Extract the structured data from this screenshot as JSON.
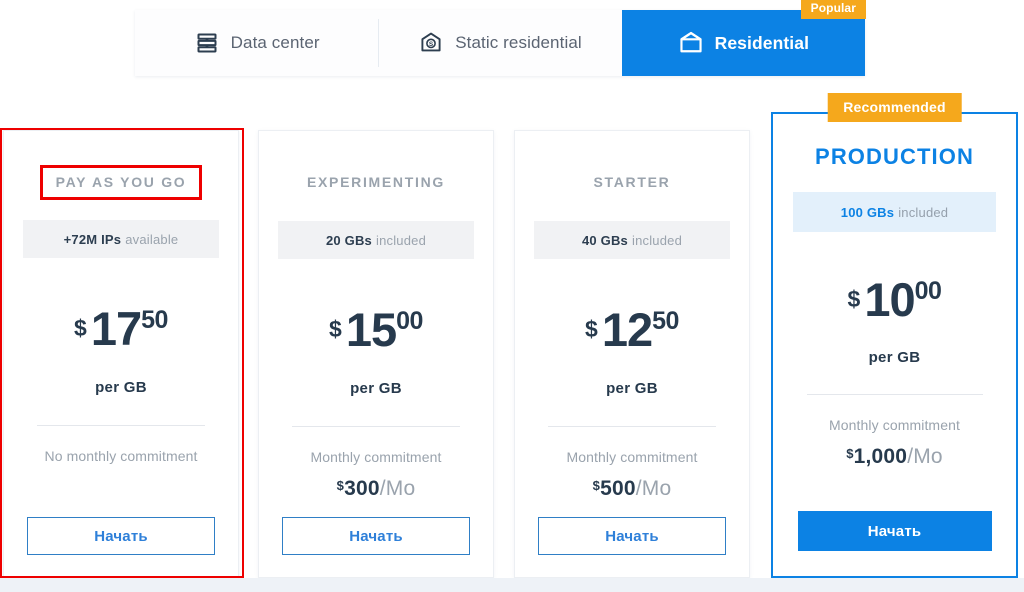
{
  "tabs": [
    {
      "label": "Data center",
      "icon": "server-rack-icon",
      "active": false,
      "badge": null
    },
    {
      "label": "Static residential",
      "icon": "house-dollar-icon",
      "active": false,
      "badge": null
    },
    {
      "label": "Residential",
      "icon": "house-icon",
      "active": true,
      "badge": "Popular"
    }
  ],
  "colors": {
    "accent_blue": "#0c82e4",
    "badge_orange": "#f5a81c",
    "annotation_red": "#ee0000",
    "price_navy": "#273a4d",
    "muted_gray": "#9aa3ad"
  },
  "plans": [
    {
      "id": "pay-as-you-go",
      "title": "PAY AS YOU GO",
      "chip_bold": "+72M IPs",
      "chip_rest": "available",
      "price_currency": "$",
      "price_int": "17",
      "price_frac": "50",
      "per_unit": "per GB",
      "commitment_label": "No monthly commitment",
      "commitment_currency": "",
      "commitment_amount": "",
      "commitment_period": "",
      "cta_label": "Начать",
      "highlighted": false,
      "annotated": true,
      "badge": null
    },
    {
      "id": "experimenting",
      "title": "EXPERIMENTING",
      "chip_bold": "20 GBs",
      "chip_rest": "included",
      "price_currency": "$",
      "price_int": "15",
      "price_frac": "00",
      "per_unit": "per GB",
      "commitment_label": "Monthly commitment",
      "commitment_currency": "$",
      "commitment_amount": "300",
      "commitment_period": "/Mo",
      "cta_label": "Начать",
      "highlighted": false,
      "annotated": false,
      "badge": null
    },
    {
      "id": "starter",
      "title": "STARTER",
      "chip_bold": "40 GBs",
      "chip_rest": "included",
      "price_currency": "$",
      "price_int": "12",
      "price_frac": "50",
      "per_unit": "per GB",
      "commitment_label": "Monthly commitment",
      "commitment_currency": "$",
      "commitment_amount": "500",
      "commitment_period": "/Mo",
      "cta_label": "Начать",
      "highlighted": false,
      "annotated": false,
      "badge": null
    },
    {
      "id": "production",
      "title": "PRODUCTION",
      "chip_bold": "100 GBs",
      "chip_rest": "included",
      "price_currency": "$",
      "price_int": "10",
      "price_frac": "00",
      "per_unit": "per GB",
      "commitment_label": "Monthly commitment",
      "commitment_currency": "$",
      "commitment_amount": "1,000",
      "commitment_period": "/Mo",
      "cta_label": "Начать",
      "highlighted": true,
      "annotated": false,
      "badge": "Recommended"
    }
  ]
}
